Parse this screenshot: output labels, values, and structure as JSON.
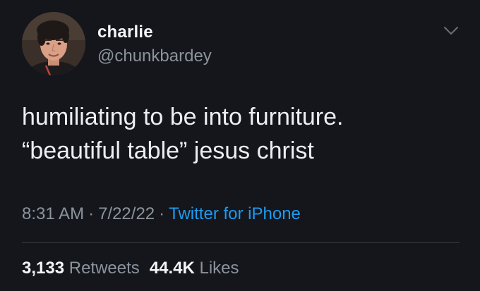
{
  "author": {
    "name": "charlie",
    "handle": "@chunkbardey"
  },
  "tweet": {
    "lines": [
      "humiliating to be into furniture.",
      "“beautiful table” jesus christ"
    ],
    "time": "8:31 AM",
    "date": "7/22/22",
    "separator": "·",
    "source": "Twitter for iPhone"
  },
  "stats": {
    "retweets_count": "3,133",
    "retweets_label": "Retweets",
    "likes_count": "44.4K",
    "likes_label": "Likes"
  },
  "colors": {
    "background": "#15161c",
    "link": "#1d9bf0",
    "muted": "#8b939b",
    "text": "#eceef0"
  },
  "icons": {
    "menu": "chevron-down-icon",
    "avatar": "profile-photo"
  }
}
